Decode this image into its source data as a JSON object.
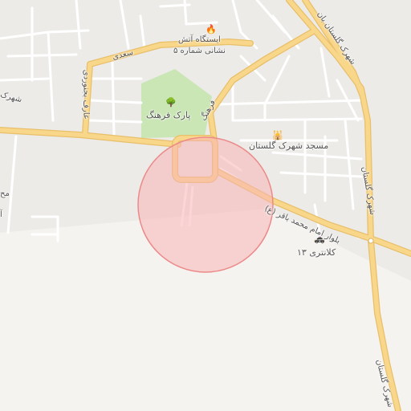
{
  "map": {
    "colors": {
      "background": "#f5f3f0",
      "built_area": "#ecebe8",
      "minor_road": "#ffffff",
      "major_road": "#f9d78a",
      "major_road_casing": "#e8bf6a",
      "park": "#c9e6b4",
      "circle_fill": "#f7b4b4",
      "circle_stroke": "#ec8a8a"
    },
    "labels": {
      "fire_station_line1": "ایستگاه آتش",
      "fire_station_line2": "نشانی شماره ۵",
      "street_saadi": "سعدی",
      "street_aref": "عارف بجنوردی",
      "street_shahrak_left": "شهرک",
      "park_farhang": "پارک فرهنگ",
      "street_farhang": "فرهنگ",
      "mosque": "مسجد شهرک گلستان",
      "blvd_imam": "بلوار امام محمد باقر (ع)",
      "police": "کلانتری ۱۳",
      "golestan_top": "شهرک گلستان بان",
      "golestan_right": "شهرک گلستان",
      "golestan_bottom": "شهرک گلستان",
      "edge_left_1": "مح",
      "edge_left_2": "آ"
    },
    "icons": {
      "fire": "🔥",
      "tree": "🌳",
      "mosque": "🕌",
      "police": "🚓"
    }
  }
}
